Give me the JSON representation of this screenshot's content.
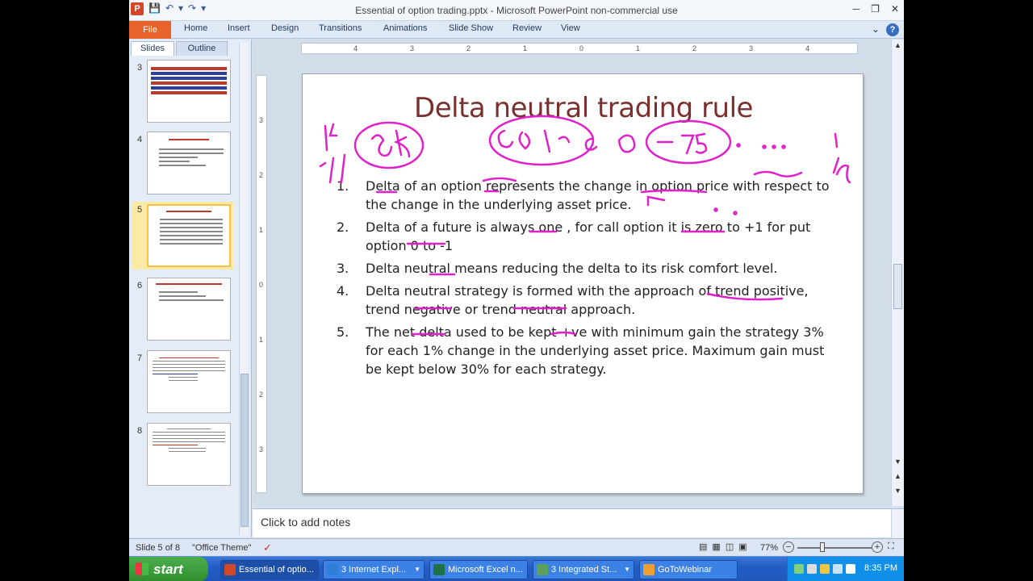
{
  "window": {
    "title": "Essential of option trading.pptx  -  Microsoft PowerPoint non-commercial use"
  },
  "ribbon": {
    "file": "File",
    "tabs": [
      "Home",
      "Insert",
      "Design",
      "Transitions",
      "Animations",
      "Slide Show",
      "Review",
      "View"
    ]
  },
  "left_pane": {
    "tabs": [
      "Slides",
      "Outline"
    ],
    "slide_numbers": [
      "3",
      "4",
      "5",
      "6",
      "7",
      "8"
    ],
    "selected_slide": "5"
  },
  "ruler": {
    "h_ticks": [
      "4",
      "3",
      "2",
      "1",
      "0",
      "1",
      "2",
      "3",
      "4"
    ],
    "v_ticks": [
      "3",
      "2",
      "1",
      "0",
      "1",
      "2",
      "3"
    ]
  },
  "slide": {
    "title": "Delta neutral trading rule",
    "items": [
      {
        "n": "1.",
        "text": "Delta of an option represents the change in option price with respect to the change in the underlying asset price."
      },
      {
        "n": "2.",
        "text": "Delta of a future is always one , for call option it is zero to +1 for put option 0 to -1"
      },
      {
        "n": "3.",
        "text": "Delta neutral means reducing the delta to its risk comfort level."
      },
      {
        "n": "4.",
        "text": "Delta neutral strategy is formed with the approach of  trend positive, trend negative or trend neutral approach."
      },
      {
        "n": "5.",
        "text": "The net delta used to be kept +ve with minimum gain the strategy 3% for each 1% change in the underlying asset price. Maximum gain must be kept below 30% for each strategy."
      }
    ],
    "ink_color": "#e020c8"
  },
  "notes": {
    "placeholder": "Click to add notes"
  },
  "status": {
    "slide_of": "Slide 5 of 8",
    "theme": "\"Office Theme\"",
    "zoom": "77%"
  },
  "taskbar": {
    "start": "start",
    "tasks": [
      {
        "label": "Essential of optio...",
        "color": "#d24726"
      },
      {
        "label": "3 Internet Expl...",
        "color": "#2f7fd8"
      },
      {
        "label": "Microsoft Excel n...",
        "color": "#1e7145"
      },
      {
        "label": "3 Integrated St...",
        "color": "#5aa05a"
      },
      {
        "label": "GoToWebinar",
        "color": "#f0a030"
      }
    ],
    "clock": "8:35 PM"
  }
}
